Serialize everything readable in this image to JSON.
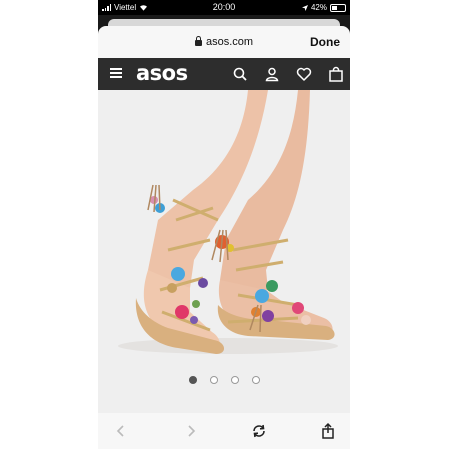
{
  "status_bar": {
    "carrier": "Viettel",
    "time": "20:00",
    "battery": "42%"
  },
  "browser": {
    "url": "asos.com",
    "done_label": "Done"
  },
  "site": {
    "logo": "asos",
    "header_icons": [
      "menu-icon",
      "search-icon",
      "account-icon",
      "heart-icon",
      "bag-icon"
    ]
  },
  "gallery": {
    "current_index": 1,
    "total_images": 4
  },
  "colors": {
    "header_bg": "#2d2d2d",
    "status_bar_bg": "#000000",
    "image_bg": "#efefef",
    "active_dot": "#555555",
    "toolbar_bg": "#f7f7f7",
    "disabled_arrow": "#bbbbbb"
  }
}
